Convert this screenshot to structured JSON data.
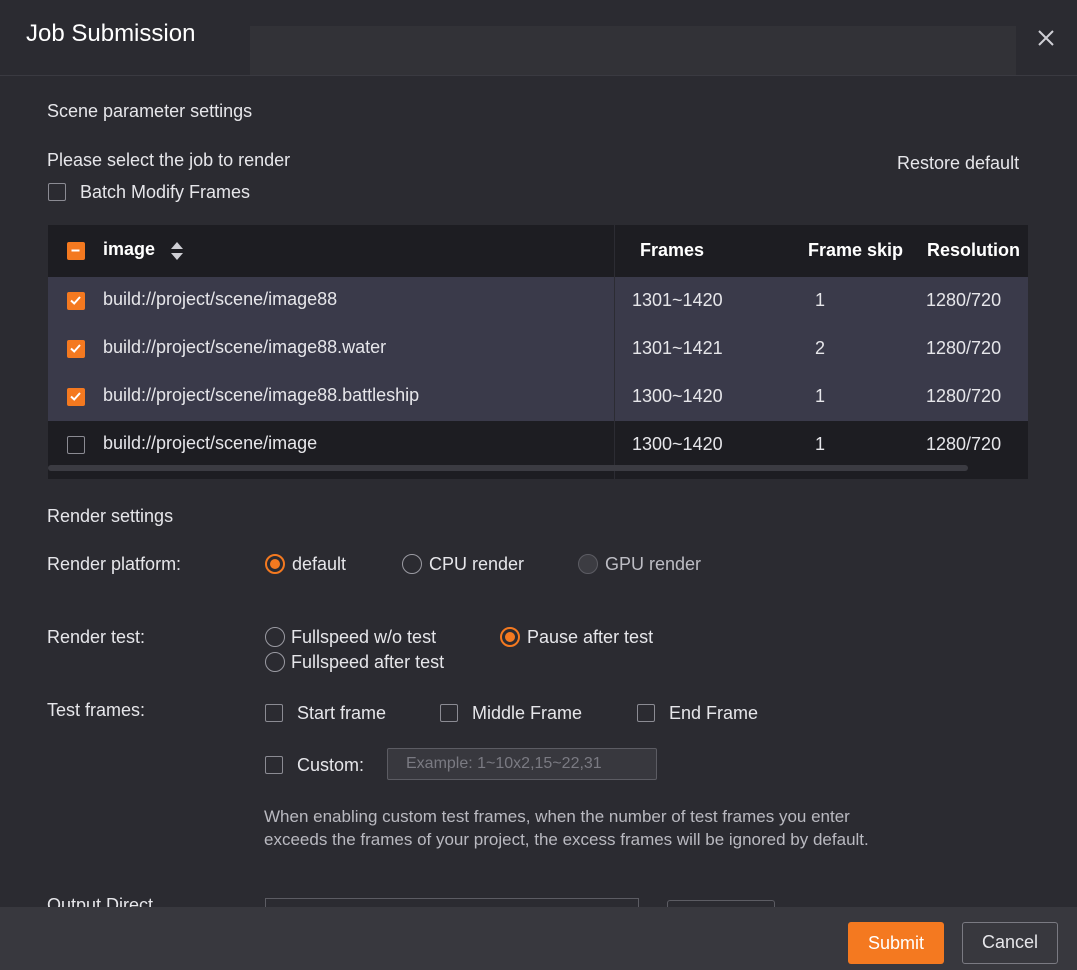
{
  "dialog": {
    "title": "Job Submission"
  },
  "scene": {
    "section_title": "Scene parameter settings",
    "select_label": "Please select the job to render",
    "restore_default": "Restore default",
    "batch_modify": "Batch Modify Frames"
  },
  "table": {
    "headers": {
      "name": "image",
      "frames": "Frames",
      "frame_skip": "Frame skip",
      "resolution": "Resolution"
    },
    "rows": [
      {
        "name": "build://project/scene/image88",
        "frames": "1301~1420",
        "skip": "1",
        "resolution": "1280/720",
        "checked": true
      },
      {
        "name": "build://project/scene/image88.water",
        "frames": "1301~1421",
        "skip": "2",
        "resolution": "1280/720",
        "checked": true
      },
      {
        "name": "build://project/scene/image88.battleship",
        "frames": "1300~1420",
        "skip": "1",
        "resolution": "1280/720",
        "checked": true
      },
      {
        "name": "build://project/scene/image",
        "frames": "1300~1420",
        "skip": "1",
        "resolution": "1280/720",
        "checked": false
      }
    ]
  },
  "render": {
    "section_title": "Render settings",
    "platform_label": "Render platform:",
    "platform_options": {
      "default": "default",
      "cpu": "CPU render",
      "gpu": "GPU render"
    },
    "platform_selected": "default",
    "test_label": "Render test:",
    "test_options": {
      "fullspeed_no_test": "Fullspeed w/o test",
      "pause_after_test": "Pause after test",
      "fullspeed_after_test": "Fullspeed after test"
    },
    "test_selected": "pause_after_test",
    "test_frames_label": "Test frames:",
    "test_frames": {
      "start": "Start frame",
      "middle": "Middle Frame",
      "end": "End Frame",
      "custom": "Custom:"
    },
    "custom_placeholder": "Example: 1~10x2,15~22,31",
    "custom_note": "When enabling custom test frames, when the number of test frames you enter exceeds the frames of your project, the excess frames will be ignored by default.",
    "output_label_partial": "Output Direct"
  },
  "footer": {
    "submit": "Submit",
    "cancel": "Cancel"
  },
  "colors": {
    "accent": "#f47920",
    "background": "#2b2b31",
    "selected_row": "#3a3a4a"
  }
}
